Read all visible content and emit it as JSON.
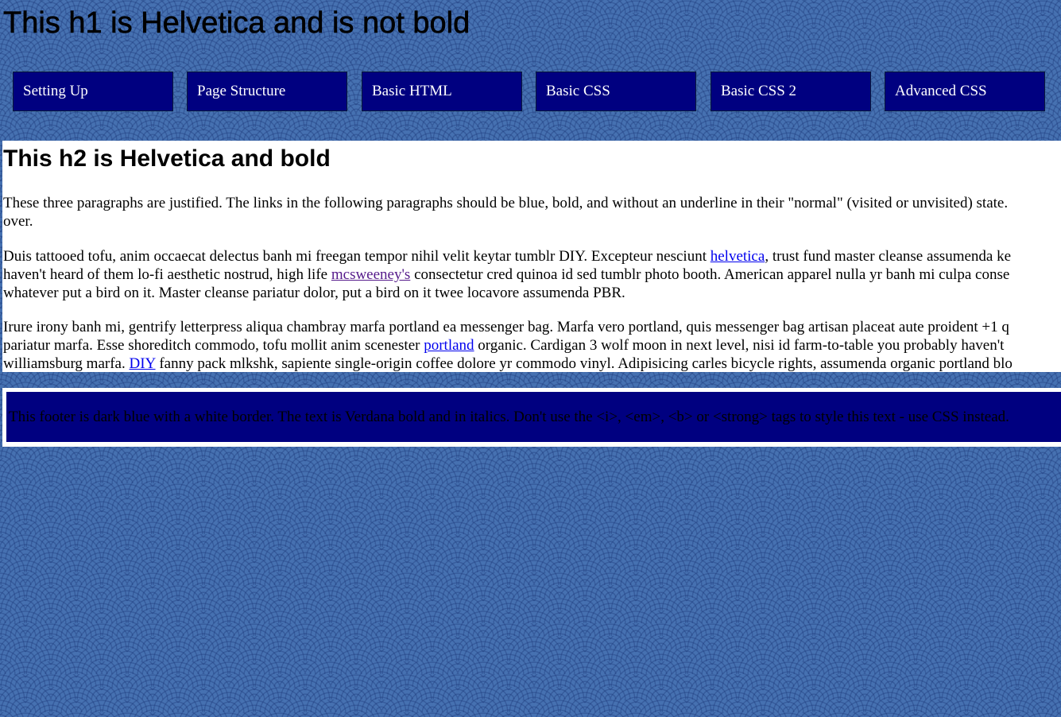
{
  "header": {
    "h1": "This h1 is Helvetica and is not bold"
  },
  "nav": {
    "items": [
      {
        "label": "Setting Up"
      },
      {
        "label": "Page Structure"
      },
      {
        "label": "Basic HTML"
      },
      {
        "label": "Basic CSS"
      },
      {
        "label": "Basic CSS 2"
      },
      {
        "label": "Advanced CSS"
      }
    ]
  },
  "main": {
    "h2": "This h2 is Helvetica and bold",
    "p1": {
      "line1": "These three paragraphs are justified. The links in the following paragraphs should be blue, bold, and without an underline in their \"normal\" (visited or unvisited) state.",
      "line2": "over."
    },
    "p2": {
      "l1_before": "Duis tattooed tofu, anim occaecat delectus banh mi freegan tempor nihil velit keytar tumblr DIY. Excepteur nesciunt ",
      "link_helvetica": "helvetica",
      "l1_after": ", trust fund master cleanse assumenda ke",
      "l2_before": "haven't heard of them lo-fi aesthetic nostrud, high life ",
      "link_mcsweeneys": "mcsweeney's",
      "l2_after": " consectetur cred quinoa id sed tumblr photo booth. American apparel nulla yr banh mi culpa conse",
      "l3": "whatever put a bird on it. Master cleanse pariatur dolor, put a bird on it twee locavore assumenda PBR."
    },
    "p3": {
      "l1": "Irure irony banh mi, gentrify letterpress aliqua chambray marfa portland ea messenger bag. Marfa vero portland, quis messenger bag artisan placeat aute proident +1 q",
      "l2_before": "pariatur marfa. Esse shoreditch commodo, tofu mollit anim scenester ",
      "link_portland": "portland",
      "l2_after": " organic. Cardigan 3 wolf moon in next level, nisi id farm-to-table you probably haven't",
      "l3_before": "williamsburg marfa. ",
      "link_diy": "DIY",
      "l3_after": " fanny pack mlkshk, sapiente single-origin coffee dolore yr commodo vinyl. Adipisicing carles bicycle rights, assumenda organic portland blo"
    }
  },
  "footer": {
    "text": "This footer is dark blue with a white border. The text is Verdana bold and in italics. Don't use the <i>, <em>, <b> or <strong> tags to style this text - use CSS instead."
  },
  "colors": {
    "background": "#4671b1",
    "nav_bg": "#000080",
    "link": "#0000ee",
    "link_visited": "#551a8b",
    "footer_bg": "#000080"
  }
}
